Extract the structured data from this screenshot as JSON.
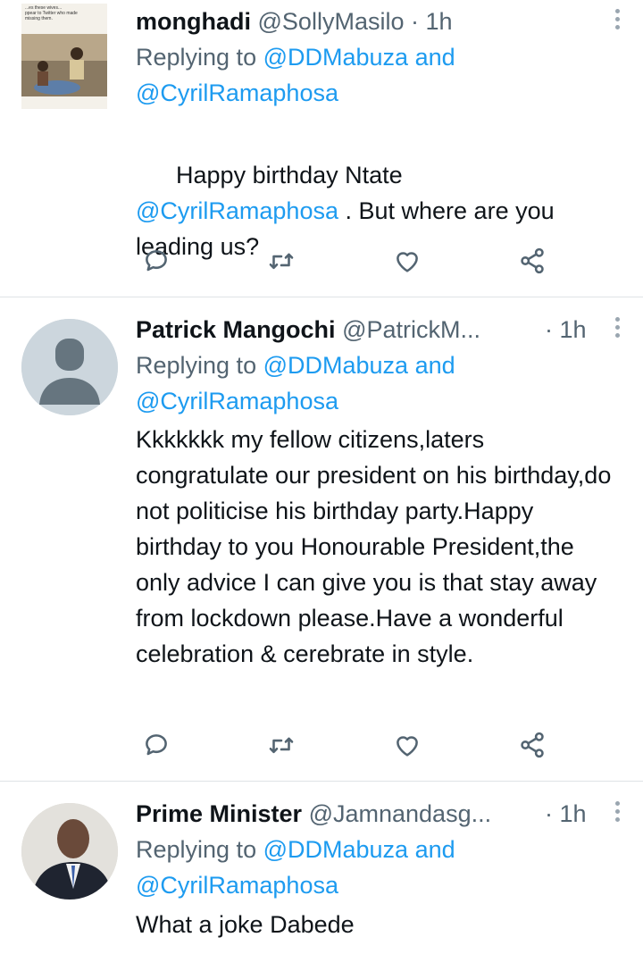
{
  "tweets": [
    {
      "name": "monghadi",
      "handle": "@SollyMasilo",
      "time": "· 1h",
      "reply_prefix": "Replying to",
      "reply_to_1": "@DDMabuza",
      "reply_and": "and",
      "reply_to_2": "@CyrilRamaphosa",
      "text_1": "Happy birthday Ntate",
      "mention": "@CyrilRamaphosa",
      "text_2": " . But where are you leading us?",
      "avatar_caption": "...es these wives...\nppear to Twitter who made\nmissing them."
    },
    {
      "name": "Patrick Mangochi",
      "handle": "@PatrickM...",
      "time": "· 1h",
      "reply_prefix": "Replying to",
      "reply_to_1": "@DDMabuza",
      "reply_and": "and",
      "reply_to_2": "@CyrilRamaphosa",
      "text": "Kkkkkkk my fellow citizens,laters congratulate our president on his birthday,do not politicise his birthday party.Happy birthday to you Honourable President,the only advice I can give you is that stay away from lockdown please.Have a wonderful celebration & cerebrate in style."
    },
    {
      "name": "Prime Minister",
      "handle": "@Jamnandasg...",
      "time": "· 1h",
      "reply_prefix": "Replying to",
      "reply_to_1": "@DDMabuza",
      "reply_and": "and",
      "reply_to_2": "@CyrilRamaphosa",
      "text": "What a joke Dabede"
    }
  ],
  "actions": [
    "reply-icon",
    "retweet-icon",
    "like-icon",
    "share-icon"
  ],
  "colors": {
    "link": "#1d9bf0",
    "secondary": "#536471",
    "divider": "#dfe3e6"
  }
}
